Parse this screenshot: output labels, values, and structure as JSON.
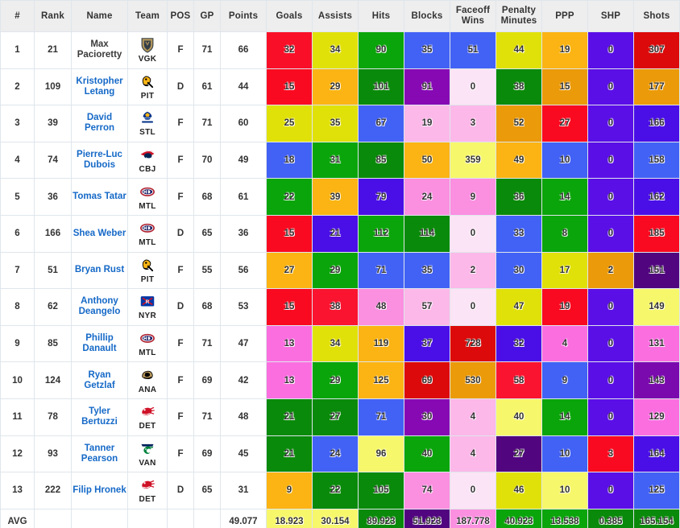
{
  "table": {
    "columns": [
      {
        "key": "num",
        "label": "#"
      },
      {
        "key": "rank",
        "label": "Rank"
      },
      {
        "key": "name",
        "label": "Name"
      },
      {
        "key": "team",
        "label": "Team"
      },
      {
        "key": "pos",
        "label": "POS"
      },
      {
        "key": "gp",
        "label": "GP"
      },
      {
        "key": "points",
        "label": "Points"
      },
      {
        "key": "goals",
        "label": "Goals"
      },
      {
        "key": "assists",
        "label": "Assists"
      },
      {
        "key": "hits",
        "label": "Hits"
      },
      {
        "key": "blocks",
        "label": "Blocks"
      },
      {
        "key": "faceoff",
        "label": "Faceoff Wins"
      },
      {
        "key": "pim",
        "label": "Penalty Minutes"
      },
      {
        "key": "ppp",
        "label": "PPP"
      },
      {
        "key": "shp",
        "label": "SHP"
      },
      {
        "key": "shots",
        "label": "Shots"
      }
    ],
    "rows": [
      {
        "num": "1",
        "rank": "21",
        "name": "Max Pacioretty",
        "name_is_link": false,
        "team": "VGK",
        "pos": "F",
        "gp": "71",
        "points": "66",
        "goals": "32",
        "assists": "34",
        "hits": "90",
        "blocks": "35",
        "faceoff": "51",
        "pim": "44",
        "ppp": "19",
        "shp": "0",
        "shots": "307",
        "colors": {
          "goals": "#FA0F28",
          "assists": "#E1E10A",
          "hits": "#0AA50A",
          "blocks": "#4262F5",
          "faceoff": "#4262F5",
          "pim": "#E1E10A",
          "ppp": "#FBB413",
          "shp": "#5A0FE6",
          "shots": "#DC0A0A"
        }
      },
      {
        "num": "2",
        "rank": "109",
        "name": "Kristopher Letang",
        "name_is_link": true,
        "team": "PIT",
        "pos": "D",
        "gp": "61",
        "points": "44",
        "goals": "15",
        "assists": "29",
        "hits": "101",
        "blocks": "91",
        "faceoff": "0",
        "pim": "38",
        "ppp": "15",
        "shp": "0",
        "shots": "177",
        "colors": {
          "goals": "#FA0A20",
          "assists": "#FBB413",
          "hits": "#0A8A0A",
          "blocks": "#8609B4",
          "faceoff": "#FBE4F5",
          "pim": "#0A8A0A",
          "ppp": "#EB9A09",
          "shp": "#5A0FE6",
          "shots": "#EB9A09"
        }
      },
      {
        "num": "3",
        "rank": "39",
        "name": "David Perron",
        "name_is_link": true,
        "team": "STL",
        "pos": "F",
        "gp": "71",
        "points": "60",
        "goals": "25",
        "assists": "35",
        "hits": "67",
        "blocks": "19",
        "faceoff": "3",
        "pim": "52",
        "ppp": "27",
        "shp": "0",
        "shots": "166",
        "colors": {
          "goals": "#E1E10A",
          "assists": "#E1E10A",
          "hits": "#4262F5",
          "blocks": "#FBB8E8",
          "faceoff": "#FBB8E8",
          "pim": "#EB9A09",
          "ppp": "#FA0A20",
          "shp": "#5A0FE6",
          "shots": "#4A0FE6"
        }
      },
      {
        "num": "4",
        "rank": "74",
        "name": "Pierre-Luc Dubois",
        "name_is_link": true,
        "team": "CBJ",
        "pos": "F",
        "gp": "70",
        "points": "49",
        "goals": "18",
        "assists": "31",
        "hits": "85",
        "blocks": "50",
        "faceoff": "359",
        "pim": "49",
        "ppp": "10",
        "shp": "0",
        "shots": "158",
        "colors": {
          "goals": "#4262F5",
          "assists": "#0AA50A",
          "hits": "#0A8A0A",
          "blocks": "#FBB413",
          "faceoff": "#F7F76B",
          "pim": "#FBB413",
          "ppp": "#4262F5",
          "shp": "#5A0FE6",
          "shots": "#4262F5"
        }
      },
      {
        "num": "5",
        "rank": "36",
        "name": "Tomas Tatar",
        "name_is_link": true,
        "team": "MTL",
        "pos": "F",
        "gp": "68",
        "points": "61",
        "goals": "22",
        "assists": "39",
        "hits": "79",
        "blocks": "24",
        "faceoff": "9",
        "pim": "36",
        "ppp": "14",
        "shp": "0",
        "shots": "162",
        "colors": {
          "goals": "#0AA50A",
          "assists": "#FBB413",
          "hits": "#4A0FE6",
          "blocks": "#FB8FE0",
          "faceoff": "#FB8FE0",
          "pim": "#0A8A0A",
          "ppp": "#0AA50A",
          "shp": "#5A0FE6",
          "shots": "#4A0FE6"
        }
      },
      {
        "num": "6",
        "rank": "166",
        "name": "Shea Weber",
        "name_is_link": true,
        "team": "MTL",
        "pos": "D",
        "gp": "65",
        "points": "36",
        "goals": "15",
        "assists": "21",
        "hits": "112",
        "blocks": "114",
        "faceoff": "0",
        "pim": "33",
        "ppp": "8",
        "shp": "0",
        "shots": "185",
        "colors": {
          "goals": "#FA0A20",
          "assists": "#4A0FE6",
          "hits": "#0AA50A",
          "blocks": "#0A8A0A",
          "faceoff": "#FBE4F5",
          "pim": "#4262F5",
          "ppp": "#0AA50A",
          "shp": "#5A0FE6",
          "shots": "#FA0A20"
        }
      },
      {
        "num": "7",
        "rank": "51",
        "name": "Bryan Rust",
        "name_is_link": true,
        "team": "PIT",
        "pos": "F",
        "gp": "55",
        "points": "56",
        "goals": "27",
        "assists": "29",
        "hits": "71",
        "blocks": "35",
        "faceoff": "2",
        "pim": "30",
        "ppp": "17",
        "shp": "2",
        "shots": "151",
        "colors": {
          "goals": "#FBB413",
          "assists": "#0AA50A",
          "hits": "#4262F5",
          "blocks": "#4262F5",
          "faceoff": "#FBB8E8",
          "pim": "#4262F5",
          "ppp": "#E1E10A",
          "shp": "#EB9A09",
          "shots": "#51067F"
        }
      },
      {
        "num": "8",
        "rank": "62",
        "name": "Anthony Deangelo",
        "name_is_link": true,
        "team": "NYR",
        "pos": "D",
        "gp": "68",
        "points": "53",
        "goals": "15",
        "assists": "38",
        "hits": "48",
        "blocks": "57",
        "faceoff": "0",
        "pim": "47",
        "ppp": "19",
        "shp": "0",
        "shots": "149",
        "colors": {
          "goals": "#FA0A20",
          "assists": "#FA1430",
          "hits": "#FB8FE0",
          "blocks": "#FBB8E8",
          "faceoff": "#FBE4F5",
          "pim": "#E1E10A",
          "ppp": "#FA0A20",
          "shp": "#5A0FE6",
          "shots": "#F7F76B"
        }
      },
      {
        "num": "9",
        "rank": "85",
        "name": "Phillip Danault",
        "name_is_link": true,
        "team": "MTL",
        "pos": "F",
        "gp": "71",
        "points": "47",
        "goals": "13",
        "assists": "34",
        "hits": "119",
        "blocks": "37",
        "faceoff": "728",
        "pim": "32",
        "ppp": "4",
        "shp": "0",
        "shots": "131",
        "colors": {
          "goals": "#FB6EE0",
          "assists": "#E1E10A",
          "hits": "#FBB413",
          "blocks": "#4A0FE6",
          "faceoff": "#DC0A0A",
          "pim": "#4A0FE6",
          "ppp": "#FB6EE0",
          "shp": "#5A0FE6",
          "shots": "#FB6EE0"
        }
      },
      {
        "num": "10",
        "rank": "124",
        "name": "Ryan Getzlaf",
        "name_is_link": true,
        "team": "ANA",
        "pos": "F",
        "gp": "69",
        "points": "42",
        "goals": "13",
        "assists": "29",
        "hits": "125",
        "blocks": "69",
        "faceoff": "530",
        "pim": "58",
        "ppp": "9",
        "shp": "0",
        "shots": "143",
        "colors": {
          "goals": "#FB6EE0",
          "assists": "#0AA50A",
          "hits": "#FBB413",
          "blocks": "#DC0A0A",
          "faceoff": "#EB9A09",
          "pim": "#FA1430",
          "ppp": "#4262F5",
          "shp": "#5A0FE6",
          "shots": "#7B0AAE"
        }
      },
      {
        "num": "11",
        "rank": "78",
        "name": "Tyler Bertuzzi",
        "name_is_link": true,
        "team": "DET",
        "pos": "F",
        "gp": "71",
        "points": "48",
        "goals": "21",
        "assists": "27",
        "hits": "71",
        "blocks": "30",
        "faceoff": "4",
        "pim": "40",
        "ppp": "14",
        "shp": "0",
        "shots": "129",
        "colors": {
          "goals": "#0A8A0A",
          "assists": "#0A8A0A",
          "hits": "#4262F5",
          "blocks": "#8609B4",
          "faceoff": "#FBB8E8",
          "pim": "#F7F76B",
          "ppp": "#0AA50A",
          "shp": "#5A0FE6",
          "shots": "#FB6EE0"
        }
      },
      {
        "num": "12",
        "rank": "93",
        "name": "Tanner Pearson",
        "name_is_link": true,
        "team": "VAN",
        "pos": "F",
        "gp": "69",
        "points": "45",
        "goals": "21",
        "assists": "24",
        "hits": "96",
        "blocks": "40",
        "faceoff": "4",
        "pim": "27",
        "ppp": "10",
        "shp": "3",
        "shots": "164",
        "colors": {
          "goals": "#0A8A0A",
          "assists": "#4262F5",
          "hits": "#F7F76B",
          "blocks": "#0AA50A",
          "faceoff": "#FBB8E8",
          "pim": "#51067F",
          "ppp": "#4262F5",
          "shp": "#FA0A20",
          "shots": "#4A0FE6"
        }
      },
      {
        "num": "13",
        "rank": "222",
        "name": "Filip Hronek",
        "name_is_link": true,
        "team": "DET",
        "pos": "D",
        "gp": "65",
        "points": "31",
        "goals": "9",
        "assists": "22",
        "hits": "105",
        "blocks": "74",
        "faceoff": "0",
        "pim": "46",
        "ppp": "10",
        "shp": "0",
        "shots": "125",
        "colors": {
          "goals": "#FBB413",
          "assists": "#0A8A0A",
          "hits": "#0A8A0A",
          "blocks": "#FB8FE0",
          "faceoff": "#FBE4F5",
          "pim": "#E1E10A",
          "ppp": "#F7F76B",
          "shp": "#5A0FE6",
          "shots": "#4262F5"
        }
      }
    ],
    "footer": {
      "label": "AVG",
      "points": "49.077",
      "goals": "18.923",
      "assists": "30.154",
      "hits": "89.923",
      "blocks": "51.923",
      "faceoff": "187.778",
      "pim": "40.923",
      "ppp": "13.538",
      "shp": "0.385",
      "shots": "165.154",
      "colors": {
        "points": "#FFFFFF",
        "goals": "#F7F76B",
        "assists": "#F7F76B",
        "hits": "#0A8A0A",
        "blocks": "#51067F",
        "faceoff": "#FB8FE0",
        "pim": "#0AA50A",
        "ppp": "#0AA50A",
        "shp": "#0A8A0A",
        "shots": "#0A8A0A"
      }
    }
  },
  "theme": {
    "link_color": "#1569C7",
    "header_bg": "#eeeeee",
    "border_color": "#dfe6ec"
  }
}
